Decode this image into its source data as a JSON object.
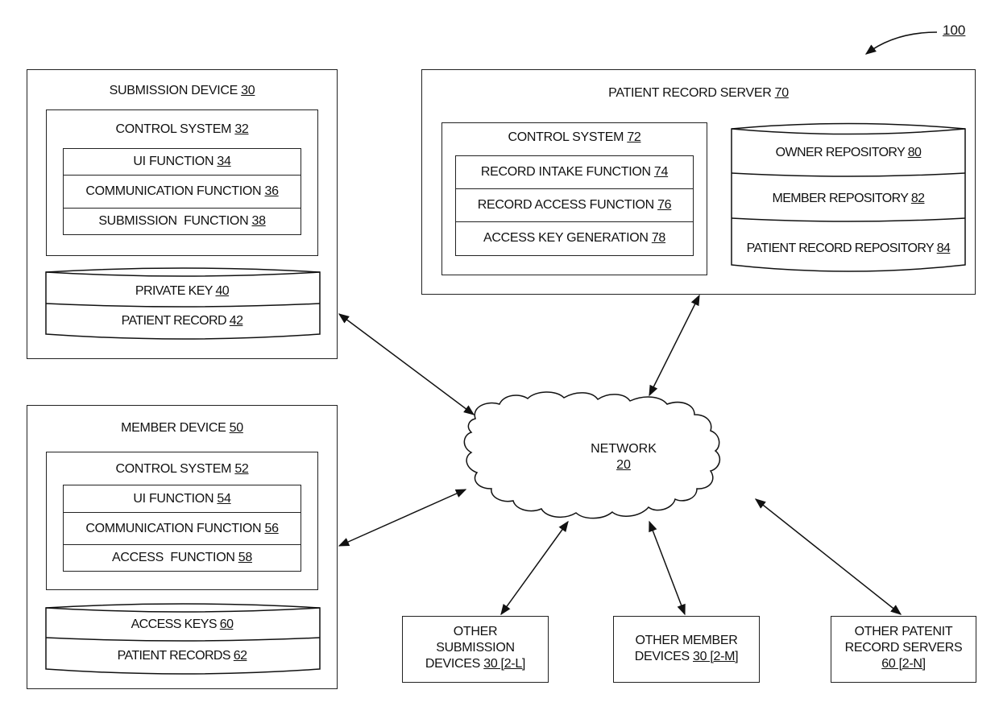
{
  "figure": {
    "ref": "100"
  },
  "submission_device": {
    "title": "SUBMISSION DEVICE",
    "num": "30",
    "control_system": {
      "title": "CONTROL SYSTEM",
      "num": "32",
      "functions": [
        {
          "label": "UI FUNCTION",
          "num": "34"
        },
        {
          "label": "COMMUNICATION FUNCTION",
          "num": "36"
        },
        {
          "label": "SUBMISSION  FUNCTION",
          "num": "38"
        }
      ]
    },
    "storage": [
      {
        "label": "PRIVATE KEY",
        "num": "40"
      },
      {
        "label": "PATIENT RECORD",
        "num": "42"
      }
    ]
  },
  "member_device": {
    "title": "MEMBER DEVICE",
    "num": "50",
    "control_system": {
      "title": "CONTROL SYSTEM",
      "num": "52",
      "functions": [
        {
          "label": "UI FUNCTION",
          "num": "54"
        },
        {
          "label": "COMMUNICATION FUNCTION",
          "num": "56"
        },
        {
          "label": "ACCESS  FUNCTION",
          "num": "58"
        }
      ]
    },
    "storage": [
      {
        "label": "ACCESS KEYS",
        "num": "60"
      },
      {
        "label": "PATIENT RECORDS",
        "num": "62"
      }
    ]
  },
  "patient_record_server": {
    "title": "PATIENT RECORD SERVER",
    "num": "70",
    "control_system": {
      "title": "CONTROL SYSTEM",
      "num": "72",
      "functions": [
        {
          "label": "RECORD INTAKE FUNCTION",
          "num": "74"
        },
        {
          "label": "RECORD ACCESS FUNCTION",
          "num": "76"
        },
        {
          "label": "ACCESS KEY GENERATION",
          "num": "78"
        }
      ]
    },
    "storage": [
      {
        "label": "OWNER REPOSITORY",
        "num": "80"
      },
      {
        "label": "MEMBER REPOSITORY",
        "num": "82"
      },
      {
        "label": "PATIENT RECORD REPOSITORY",
        "num": "84"
      }
    ]
  },
  "network": {
    "label": "NETWORK",
    "num": "20"
  },
  "others": [
    {
      "lines": [
        "OTHER",
        "SUBMISSION",
        "DEVICES"
      ],
      "num": "30 [2-L]"
    },
    {
      "lines": [
        "OTHER MEMBER",
        "DEVICES"
      ],
      "num": "30 [2-M]"
    },
    {
      "lines": [
        "OTHER PATENIT",
        "RECORD SERVERS"
      ],
      "num": "60 [2-N]"
    }
  ]
}
